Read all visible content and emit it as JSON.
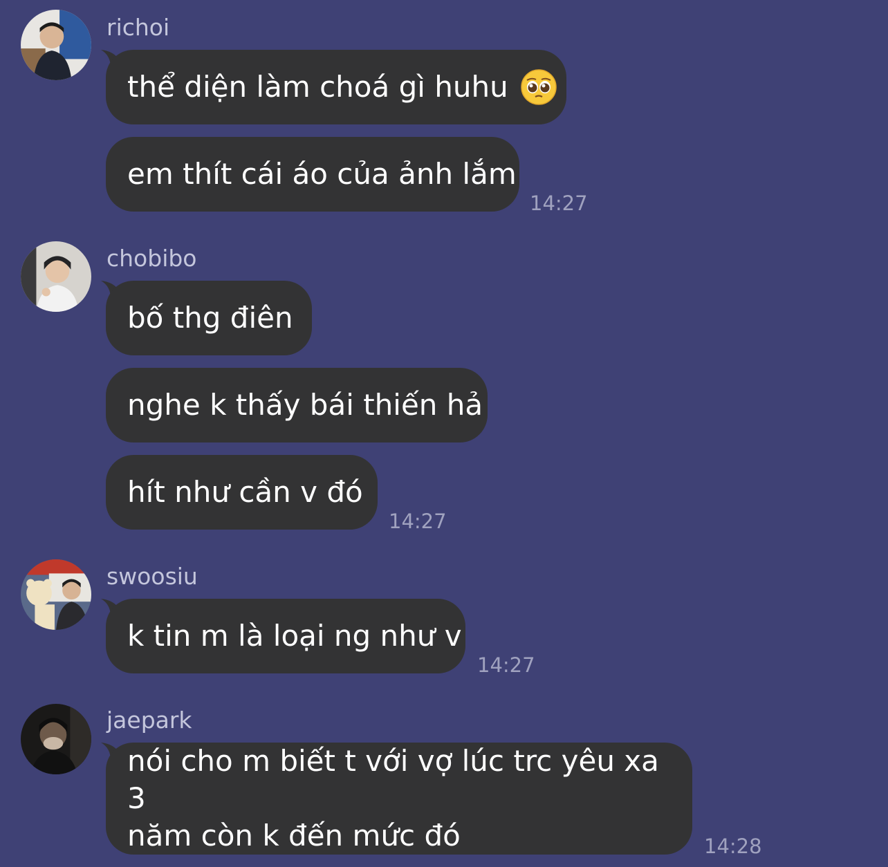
{
  "groups": [
    {
      "sender": "richoi",
      "messages": [
        "thể diện làm choá gì huhu",
        "em thít cái áo của ảnh lắm"
      ],
      "time": "14:27",
      "emoji": "pleading-face-emoji"
    },
    {
      "sender": "chobibo",
      "messages": [
        "bố thg điên",
        "nghe k thấy bái thiến hả",
        "hít như cần v đó"
      ],
      "time": "14:27"
    },
    {
      "sender": "swoosiu",
      "messages": [
        "k tin m là loại ng như v"
      ],
      "time": "14:27"
    },
    {
      "sender": "jaepark",
      "messages": [
        "nói cho m biết t với vợ lúc trc yêu xa 3",
        "năm còn k đến mức đó"
      ],
      "time": "14:28"
    }
  ],
  "colors": {
    "background": "#3f4175",
    "bubble": "#333334",
    "bubble_text": "#ffffff",
    "sender_text": "#c4c6dc",
    "time_text": "#a0a2bf"
  }
}
